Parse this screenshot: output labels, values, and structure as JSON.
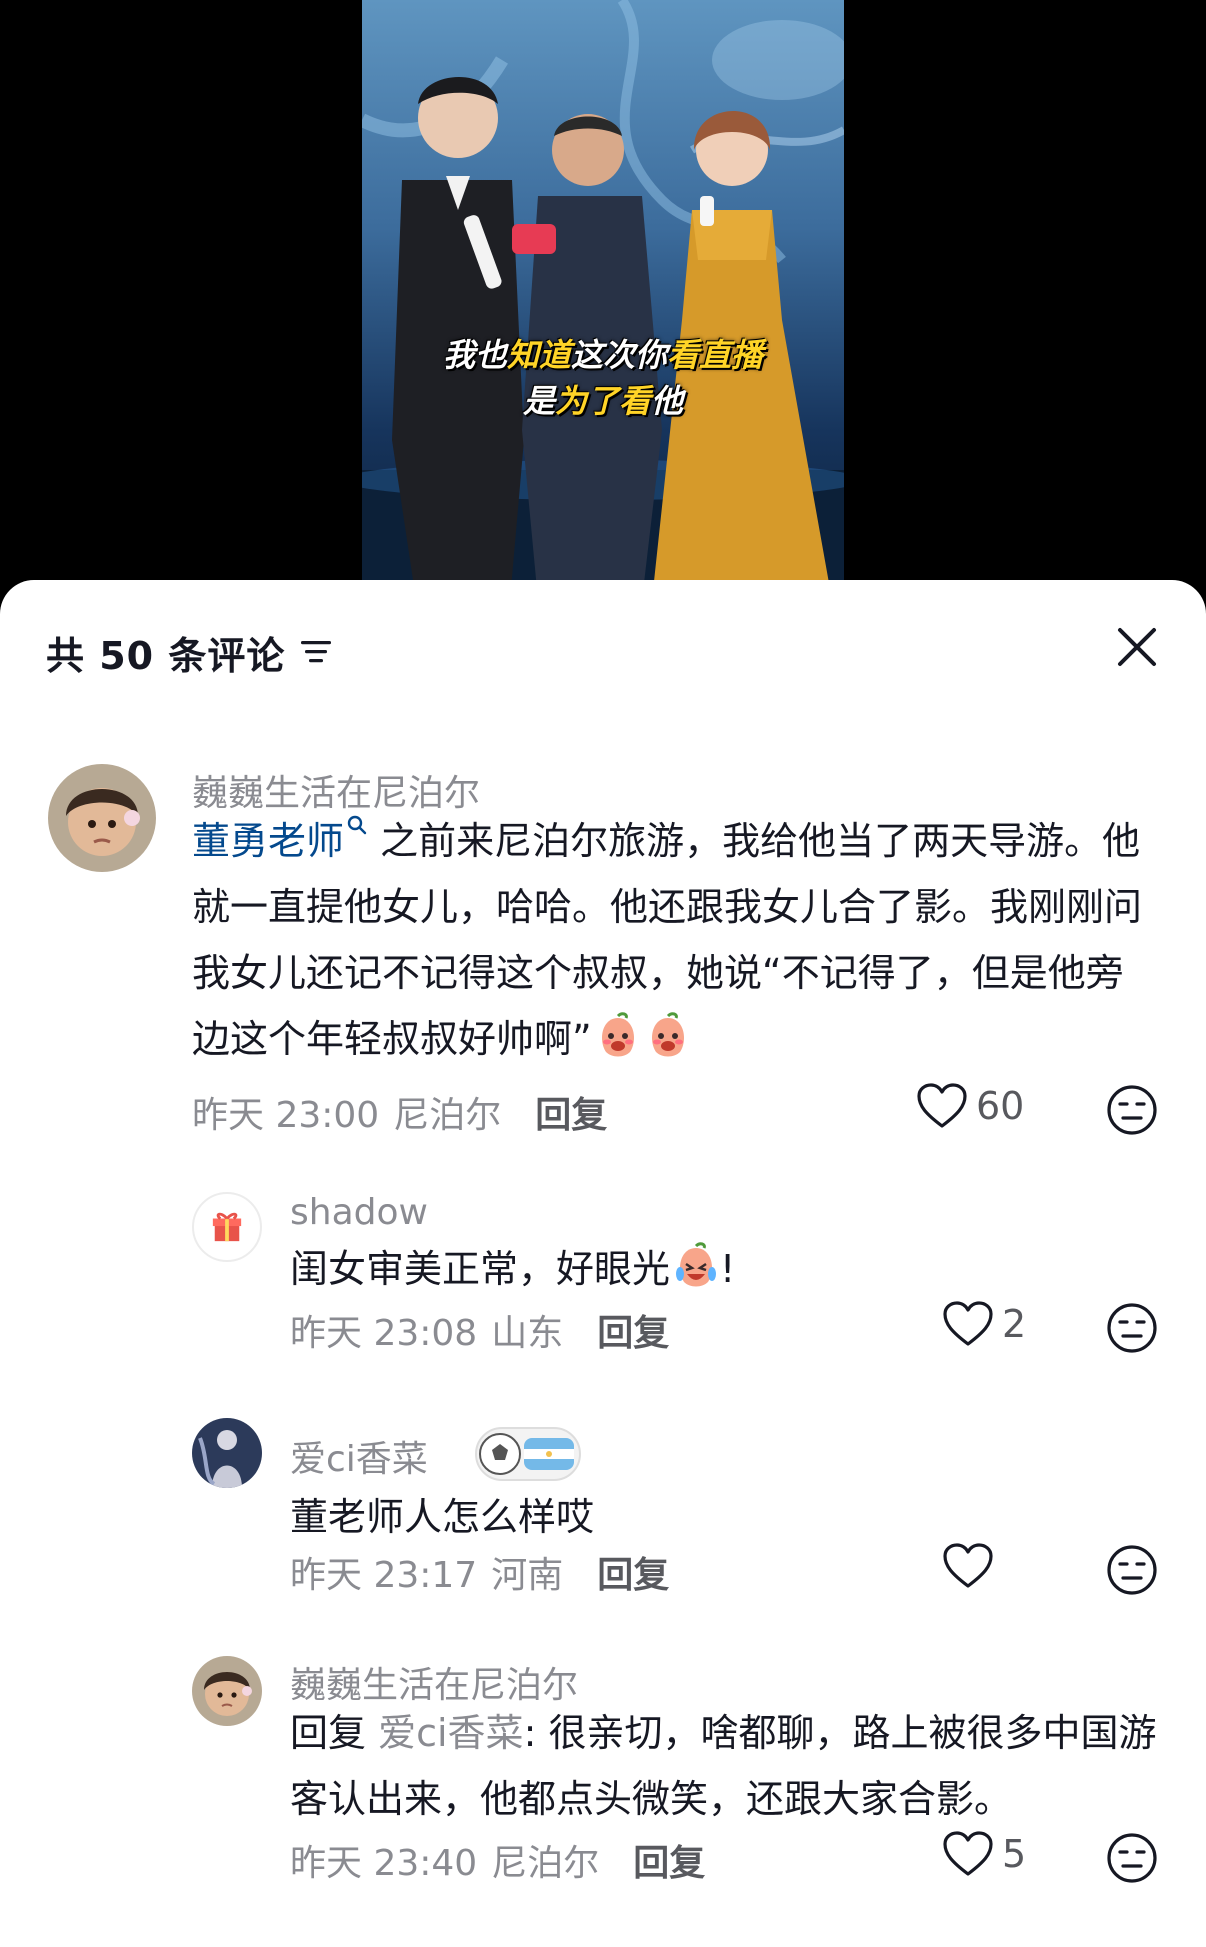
{
  "video": {
    "subtitle_line1": {
      "pre": "我也",
      "hl1": "知道",
      "mid": "这次你",
      "hl2": "看直播"
    },
    "subtitle_line2": {
      "pre": "是",
      "hl": "为了看",
      "post": "他"
    }
  },
  "header": {
    "title": "共 50 条评论",
    "sort_icon": "sort-lines-icon",
    "close_icon": "close-icon"
  },
  "comments": [
    {
      "username": "巍巍生活在尼泊尔",
      "mention": "董勇老师",
      "text": "之前来尼泊尔旅游，我给他当了两天导游。他就一直提他女儿，哈哈。他还跟我女儿合了影。我刚刚问我女儿还记不记得这个叔叔，她说“不记得了，但是他旁边这个年轻叔叔好帅啊”",
      "emoji": "peach-shy-emoji",
      "time": "昨天 23:00",
      "location": "尼泊尔",
      "reply_label": "回复",
      "likes": "60"
    },
    {
      "username": "shadow",
      "text": "闺女审美正常，好眼光",
      "emoji": "crying-laugh-emoji",
      "suffix": "!",
      "time": "昨天 23:08",
      "location": "山东",
      "reply_label": "回复",
      "likes": "2"
    },
    {
      "username": "爱ci香菜",
      "badge": "soccer-argentina-badge",
      "text": "董老师人怎么样哎",
      "time": "昨天 23:17",
      "location": "河南",
      "reply_label": "回复",
      "likes": ""
    },
    {
      "username": "巍巍生活在尼泊尔",
      "reply_prefix": "回复",
      "reply_to": "爱ci香菜",
      "text": ": 很亲切，啥都聊，路上被很多中国游客认出来，他都点头微笑，还跟大家合影。",
      "time": "昨天 23:40",
      "location": "尼泊尔",
      "reply_label": "回复",
      "likes": "5"
    }
  ],
  "colors": {
    "text": "#161823",
    "muted": "#8a8b91",
    "mention": "#04498d",
    "subtitle_highlight": "#ffd427"
  }
}
